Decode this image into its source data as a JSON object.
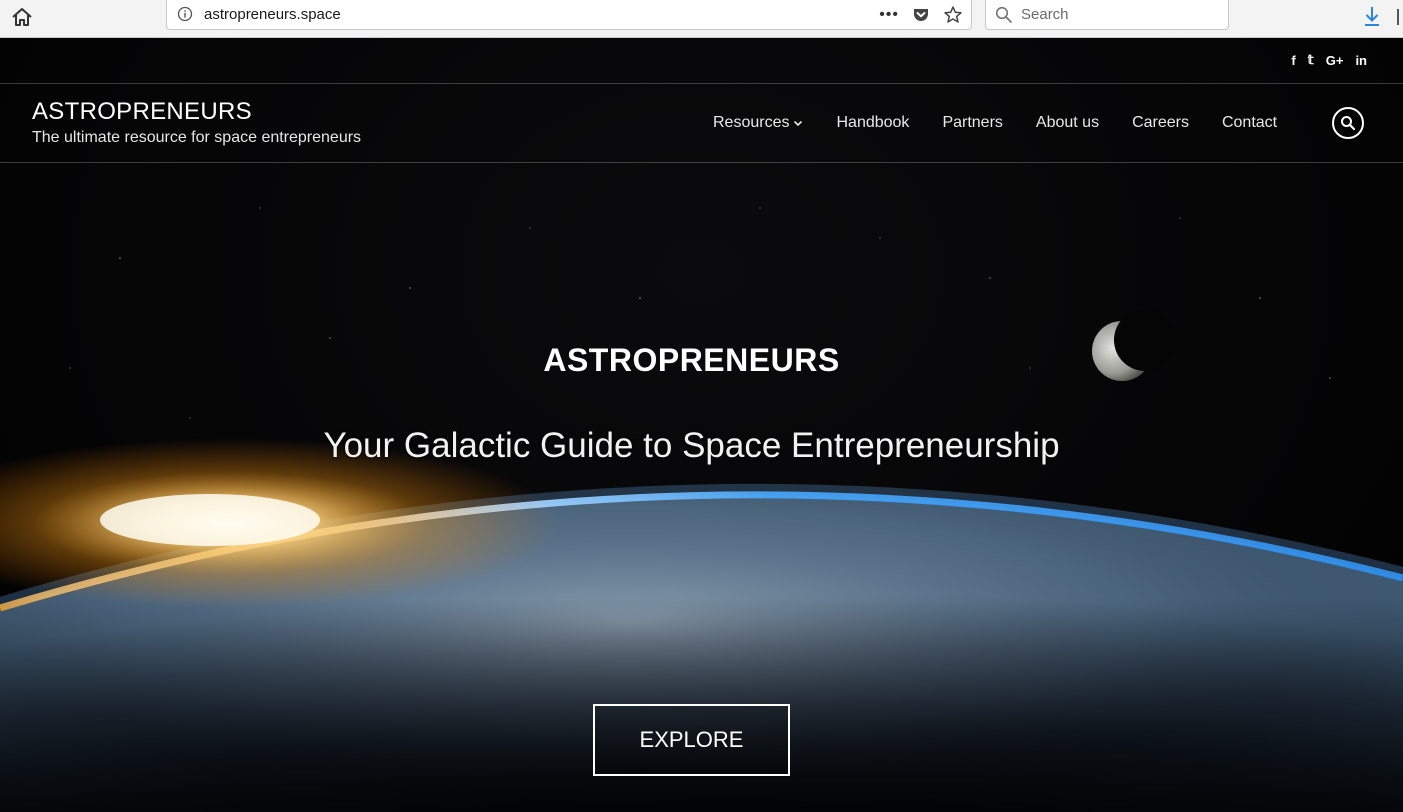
{
  "browser": {
    "url": "astropreneurs.space",
    "search_placeholder": "Search",
    "more_menu": "•••",
    "icons": [
      "home-icon",
      "info-icon",
      "pocket-icon",
      "bookmark-star-icon",
      "search-icon",
      "download-icon"
    ]
  },
  "site": {
    "social": [
      "f",
      "𝕥",
      "G+",
      "in"
    ],
    "social_icons": [
      "facebook-icon",
      "twitter-icon",
      "google-plus-icon",
      "linkedin-icon"
    ],
    "title": "ASTROPRENEURS",
    "tagline": "The ultimate resource for space entrepreneurs",
    "nav": {
      "resources": "Resources",
      "handbook": "Handbook",
      "partners": "Partners",
      "about": "About us",
      "careers": "Careers",
      "contact": "Contact"
    }
  },
  "hero": {
    "title": "ASTROPRENEURS",
    "subtitle": "Your Galactic Guide to Space Entrepreneurship",
    "cta": "EXPLORE"
  },
  "colors": {
    "chrome_bg": "#f3f3f3",
    "download_accent": "#2a86de",
    "sunrise": "#ffb020",
    "atmosphere": "#2d8fe6"
  }
}
